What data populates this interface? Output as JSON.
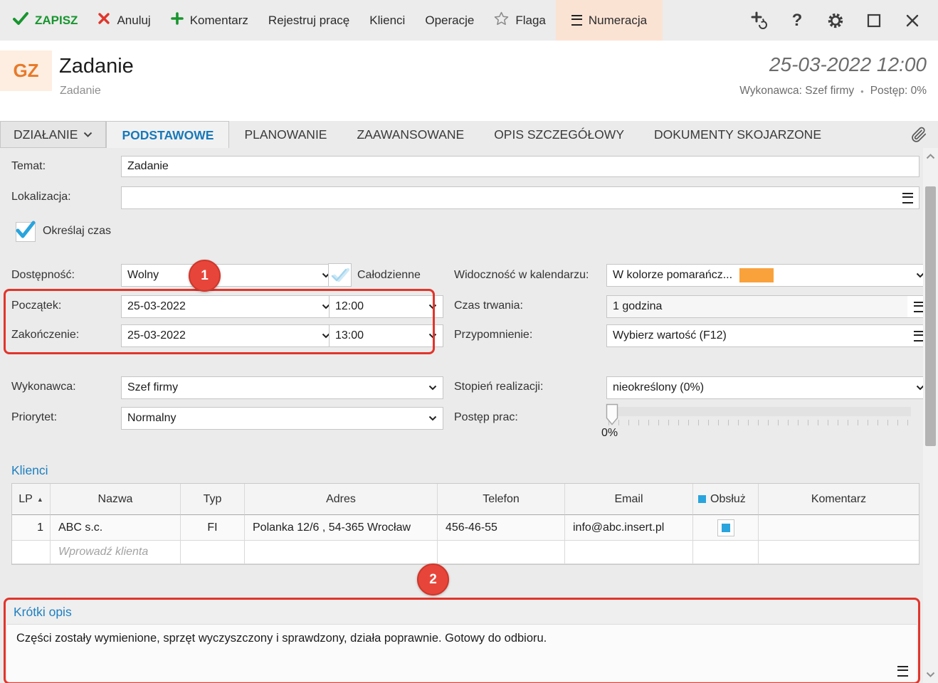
{
  "toolbar": {
    "save": "ZAPISZ",
    "cancel": "Anuluj",
    "comment": "Komentarz",
    "register_work": "Rejestruj pracę",
    "clients": "Klienci",
    "operations": "Operacje",
    "flag": "Flaga",
    "numbering": "Numeracja"
  },
  "header": {
    "avatar": "GZ",
    "title": "Zadanie",
    "subtitle": "Zadanie",
    "datetime": "25-03-2022 12:00",
    "meta_executor": "Wykonawca: Szef firmy",
    "meta_separator": "•",
    "meta_progress": "Postęp: 0%"
  },
  "tabs": {
    "action": "DZIAŁANIE",
    "items": [
      "PODSTAWOWE",
      "PLANOWANIE",
      "ZAAWANSOWANE",
      "OPIS SZCZEGÓŁOWY",
      "DOKUMENTY SKOJARZONE"
    ]
  },
  "form": {
    "temat": {
      "label": "Temat:",
      "value": "Zadanie"
    },
    "lokalizacja": {
      "label": "Lokalizacja:",
      "value": ""
    },
    "okreslaj_czas": {
      "label": "Określaj czas",
      "checked": true
    },
    "dostepnosc": {
      "label": "Dostępność:",
      "value": "Wolny"
    },
    "calodzienne": {
      "label": "Całodzienne"
    },
    "widocznosc": {
      "label": "Widoczność w kalendarzu:",
      "value": "W kolorze pomarańcz...",
      "swatch_color": "#f9a23c"
    },
    "poczatek": {
      "label": "Początek:",
      "date": "25-03-2022",
      "time": "12:00"
    },
    "czas_trwania": {
      "label": "Czas trwania:",
      "value": "1 godzina"
    },
    "zakonczenie": {
      "label": "Zakończenie:",
      "date": "25-03-2022",
      "time": "13:00"
    },
    "przypomnienie": {
      "label": "Przypomnienie:",
      "value": "Wybierz wartość (F12)"
    },
    "wykonawca": {
      "label": "Wykonawca:",
      "value": "Szef firmy"
    },
    "stopien": {
      "label": "Stopień realizacji:",
      "value": "nieokreślony (0%)"
    },
    "priorytet": {
      "label": "Priorytet:",
      "value": "Normalny"
    },
    "postep": {
      "label": "Postęp prac:",
      "percent_label": "0%"
    }
  },
  "annotations": {
    "badge_one": "1",
    "badge_two": "2"
  },
  "klienci": {
    "section_title": "Klienci",
    "columns": [
      "LP",
      "Nazwa",
      "Typ",
      "Adres",
      "Telefon",
      "Email",
      "Obsłuż",
      "Komentarz"
    ],
    "rows": [
      {
        "lp": "1",
        "nazwa": "ABC s.c.",
        "typ": "FI",
        "adres": "Polanka 12/6 , 54-365 Wrocław",
        "telefon": "456-46-55",
        "email": "info@abc.insert.pl",
        "obsluzony": true,
        "komentarz": ""
      }
    ],
    "new_row_placeholder": "Wprowadź klienta"
  },
  "opis": {
    "title": "Krótki opis",
    "text": "Części zostały wymienione, sprzęt wyczyszczony i sprawdzony, działa poprawnie. Gotowy do odbioru."
  },
  "colors": {
    "accent_blue": "#1779ba",
    "section_blue": "#1c7fc0",
    "save_green": "#18952f",
    "cancel_red": "#e0352b",
    "annotation_red": "#e8453a",
    "checkbox_blue": "#29a4dd",
    "calendar_orange": "#f9a23c",
    "numbering_highlight": "#fbe3d4"
  }
}
